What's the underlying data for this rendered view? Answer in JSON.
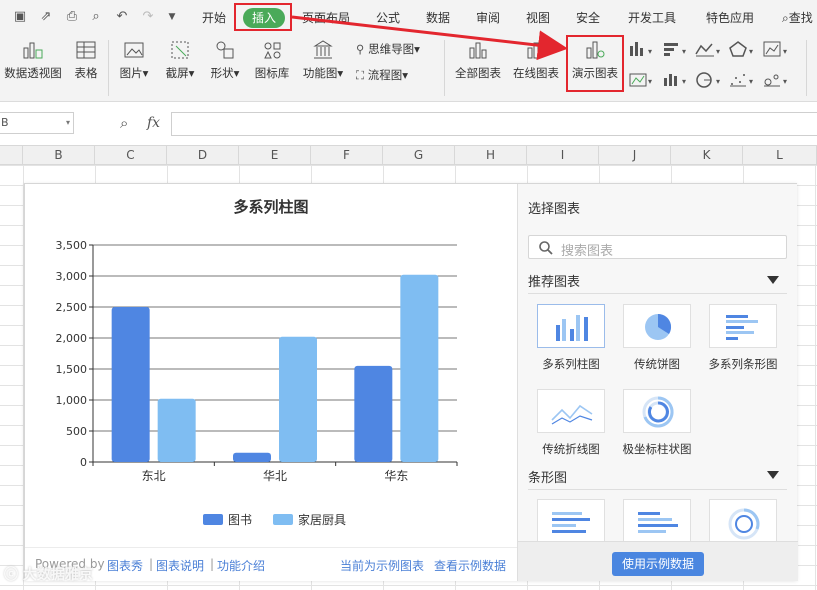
{
  "menubar": {
    "tabs": [
      "开始",
      "插入",
      "页面布局",
      "公式",
      "数据",
      "审阅",
      "视图",
      "安全",
      "开发工具",
      "特色应用",
      "查找"
    ],
    "active_tab": "插入",
    "active_color": "#4aaa59",
    "highlight_color": "#e3262e"
  },
  "ribbon": {
    "pivot_table": "数据透视图",
    "table": "表格",
    "picture": "图片",
    "screenshot": "截屏",
    "shape": "形状",
    "icon_lib": "图标库",
    "function_chart": "功能图",
    "mind_map": "思维导图",
    "flowchart": "流程图",
    "all_charts": "全部图表",
    "online_charts": "在线图表",
    "demo_charts": "演示图表"
  },
  "formula": {
    "namebox": "B",
    "fx": "fx"
  },
  "columns": [
    "B",
    "C",
    "D",
    "E",
    "F",
    "G",
    "H",
    "I",
    "J",
    "K",
    "L"
  ],
  "chart": {
    "footer": {
      "powered_by": "Powered by",
      "brand": "图表秀",
      "sep": "|",
      "help": "图表说明",
      "features": "功能介绍",
      "sample_note": "当前为示例图表",
      "view_sample": "查看示例数据"
    }
  },
  "chart_data": {
    "type": "bar",
    "title": "多系列柱图",
    "categories": [
      "东北",
      "华北",
      "华东"
    ],
    "series": [
      {
        "name": "图书",
        "values": [
          2500,
          150,
          1550
        ],
        "color": "#4f86e2"
      },
      {
        "name": "家居厨具",
        "values": [
          1020,
          2020,
          3020
        ],
        "color": "#7fbdf2"
      }
    ],
    "ylim": [
      0,
      3500
    ],
    "yticks": [
      "0",
      "500",
      "1,000",
      "1,500",
      "2,000",
      "2,500",
      "3,000",
      "3,500"
    ],
    "grid": true,
    "legend": "bottom"
  },
  "side": {
    "title": "选择图表",
    "search_placeholder": "搜索图表",
    "recommended": "推荐图表",
    "bar_section": "条形图",
    "tiles": [
      {
        "label": "多系列柱图",
        "icon": "multi-bar-chart-icon"
      },
      {
        "label": "传统饼图",
        "icon": "pie-chart-icon"
      },
      {
        "label": "多系列条形图",
        "icon": "multi-hbar-chart-icon"
      },
      {
        "label": "传统折线图",
        "icon": "line-chart-icon"
      },
      {
        "label": "极坐标柱状图",
        "icon": "polar-bar-chart-icon"
      }
    ],
    "use_sample": "使用示例数据"
  },
  "watermark": "大数据雅京"
}
